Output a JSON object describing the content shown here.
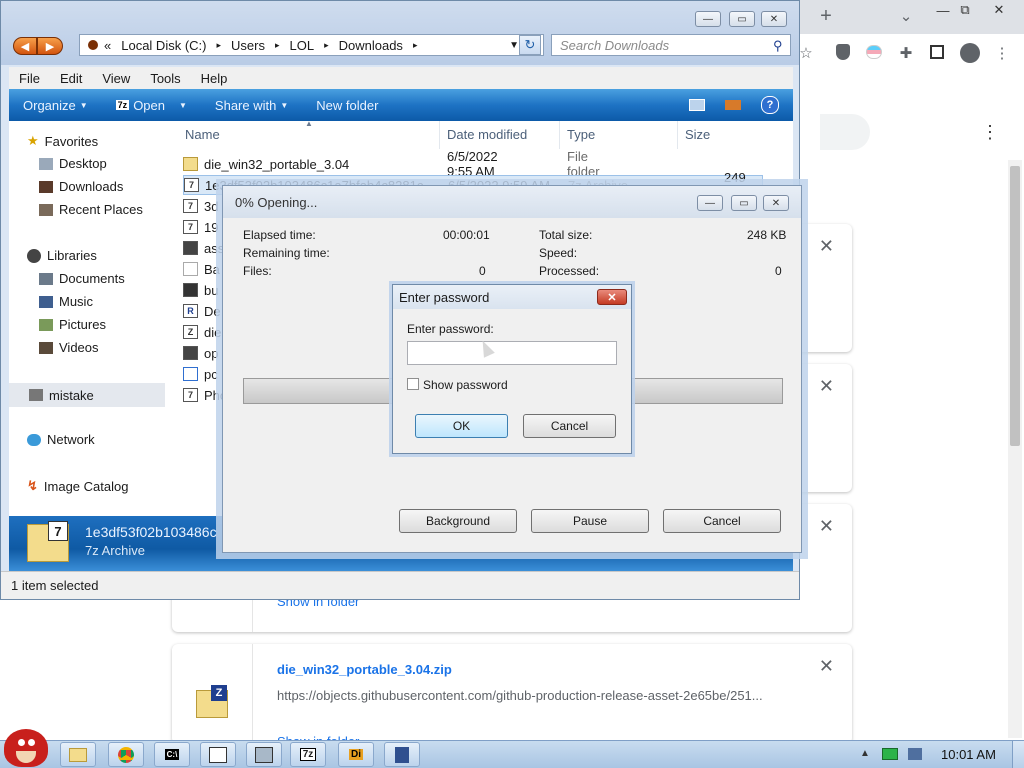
{
  "chrome": {
    "new_tab": "+",
    "collapse": "⌄",
    "win_min": "—",
    "win_max": "⧉",
    "win_close": "✕",
    "menu_dots": "⋮",
    "cards": [
      {
        "close": "✕"
      },
      {
        "close": "✕"
      },
      {
        "close": "✕",
        "link": "Show in folder"
      },
      {
        "close": "✕",
        "name": "die_win32_portable_3.04.zip",
        "url": "https://objects.githubusercontent.com/github-production-release-asset-2e65be/251...",
        "link": "Show in folder"
      }
    ]
  },
  "explorer": {
    "breadcrumb": [
      "«",
      "Local Disk (C:)",
      "Users",
      "LOL",
      "Downloads"
    ],
    "search_placeholder": "Search Downloads",
    "menu": [
      "File",
      "Edit",
      "View",
      "Tools",
      "Help"
    ],
    "commands": {
      "organize": "Organize",
      "open": "Open",
      "share": "Share with",
      "newfolder": "New folder"
    },
    "nav": {
      "favorites": "Favorites",
      "desktop": "Desktop",
      "downloads": "Downloads",
      "recent": "Recent Places",
      "libraries": "Libraries",
      "documents": "Documents",
      "music": "Music",
      "pictures": "Pictures",
      "videos": "Videos",
      "mistake": "mistake",
      "network": "Network",
      "catalog": "Image Catalog"
    },
    "columns": {
      "name": "Name",
      "date": "Date modified",
      "type": "Type",
      "size": "Size"
    },
    "files": [
      {
        "name": "die_win32_portable_3.04",
        "date": "6/5/2022 9:55 AM",
        "type": "File folder",
        "size": ""
      },
      {
        "name": "1e3df53f02b103486c1a7bfab4c8281c",
        "date": "6/5/2022 9:59 AM",
        "type": "7z Archive",
        "size": "249 KB"
      },
      {
        "name": "3d",
        "date": "",
        "type": "",
        "size": ""
      },
      {
        "name": "19",
        "date": "",
        "type": "",
        "size": ""
      },
      {
        "name": "ass",
        "date": "",
        "type": "",
        "size": ""
      },
      {
        "name": "Ba",
        "date": "",
        "type": "",
        "size": ""
      },
      {
        "name": "bu",
        "date": "",
        "type": "",
        "size": ""
      },
      {
        "name": "De",
        "date": "",
        "type": "",
        "size": ""
      },
      {
        "name": "die",
        "date": "",
        "type": "",
        "size": ""
      },
      {
        "name": "op",
        "date": "",
        "type": "",
        "size": ""
      },
      {
        "name": "pc",
        "date": "",
        "type": "",
        "size": ""
      },
      {
        "name": "Pho",
        "date": "",
        "type": "",
        "size": ""
      }
    ],
    "details": {
      "filename": "1e3df53f02b103486c",
      "filetype": "7z Archive"
    },
    "status": "1 item selected"
  },
  "progress": {
    "title": "0% Opening...",
    "elapsed_label": "Elapsed time:",
    "elapsed_value": "00:00:01",
    "remaining_label": "Remaining time:",
    "files_label": "Files:",
    "files_value": "0",
    "total_label": "Total size:",
    "total_value": "248 KB",
    "speed_label": "Speed:",
    "processed_label": "Processed:",
    "processed_value": "0",
    "buttons": {
      "background": "Background",
      "pause": "Pause",
      "cancel": "Cancel"
    }
  },
  "password_dialog": {
    "title": "Enter password",
    "prompt": "Enter password:",
    "value": "",
    "show_password": "Show password",
    "ok": "OK",
    "cancel": "Cancel"
  },
  "taskbar": {
    "apps": [
      "angry-birds",
      "explorer",
      "chrome",
      "cmd",
      "document",
      "network-tool",
      "7zip",
      "die",
      "calculator"
    ],
    "labels": {
      "cmd": "C:\\",
      "sevenzip": "7z",
      "die": "Di"
    },
    "clock": "10:01 AM",
    "tray_arrow": "▲"
  }
}
